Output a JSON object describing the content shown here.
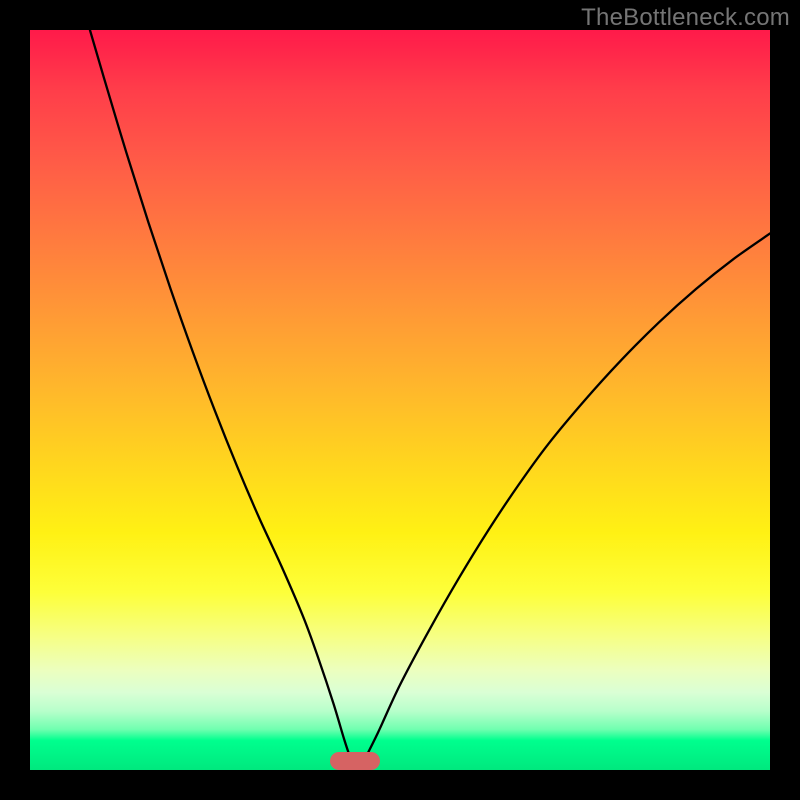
{
  "watermark": "TheBottleneck.com",
  "marker": {
    "left_pct": 40.5,
    "width_pct": 6.8
  },
  "chart_data": {
    "type": "line",
    "title": "",
    "xlabel": "",
    "ylabel": "",
    "xlim": [
      0,
      100
    ],
    "ylim": [
      0,
      100
    ],
    "background_gradient": {
      "top": "#ff1a4a",
      "middle": "#ffd41f",
      "bottom": "#00e87e"
    },
    "series": [
      {
        "name": "left-branch",
        "x": [
          8.1,
          10,
          13,
          16,
          19,
          22,
          25,
          28,
          31,
          34,
          37,
          39,
          41,
          42.5,
          43.5
        ],
        "y": [
          100,
          93.5,
          83.5,
          74,
          65,
          56.5,
          48.5,
          41,
          34,
          27.5,
          20.5,
          15,
          9,
          4,
          1
        ]
      },
      {
        "name": "right-branch",
        "x": [
          45,
          47,
          50,
          54,
          58,
          62,
          66,
          70,
          75,
          80,
          85,
          90,
          95,
          100
        ],
        "y": [
          1,
          5,
          11.5,
          19,
          26,
          32.5,
          38.5,
          44,
          50,
          55.5,
          60.5,
          65,
          69,
          72.5
        ]
      }
    ],
    "minimum_marker": {
      "x_center_pct": 44,
      "width_pct": 6.8,
      "color": "#d66363"
    }
  }
}
